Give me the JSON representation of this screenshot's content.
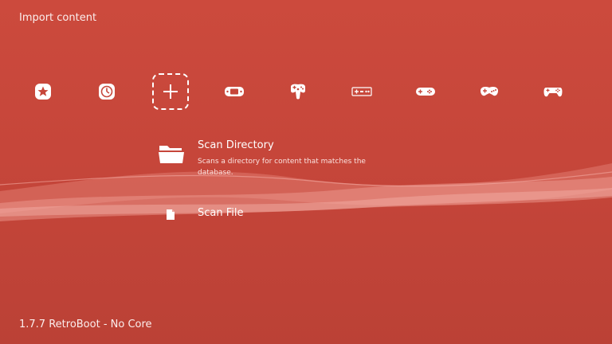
{
  "header": {
    "title": "Import content"
  },
  "tabs": [
    {
      "icon": "favorites-star-icon",
      "selected": false
    },
    {
      "icon": "history-clock-icon",
      "selected": false
    },
    {
      "icon": "add-plus-icon",
      "selected": true
    },
    {
      "icon": "gameboy-advance-icon",
      "selected": false
    },
    {
      "icon": "n64-controller-icon",
      "selected": false
    },
    {
      "icon": "nes-controller-icon",
      "selected": false
    },
    {
      "icon": "snes-controller-icon",
      "selected": false
    },
    {
      "icon": "genesis-controller-icon",
      "selected": false
    },
    {
      "icon": "ps-controller-icon",
      "selected": false
    }
  ],
  "menu": {
    "items": [
      {
        "icon": "folder-icon",
        "label": "Scan Directory",
        "sublabel": "Scans a directory for content that matches the database."
      },
      {
        "icon": "file-icon",
        "label": "Scan File",
        "sublabel": ""
      }
    ]
  },
  "footer": {
    "status": "1.7.7 RetroBoot - No Core"
  },
  "colors": {
    "background": "#c6463a",
    "accent": "#ffffff",
    "ribbon": "#e8867c"
  }
}
